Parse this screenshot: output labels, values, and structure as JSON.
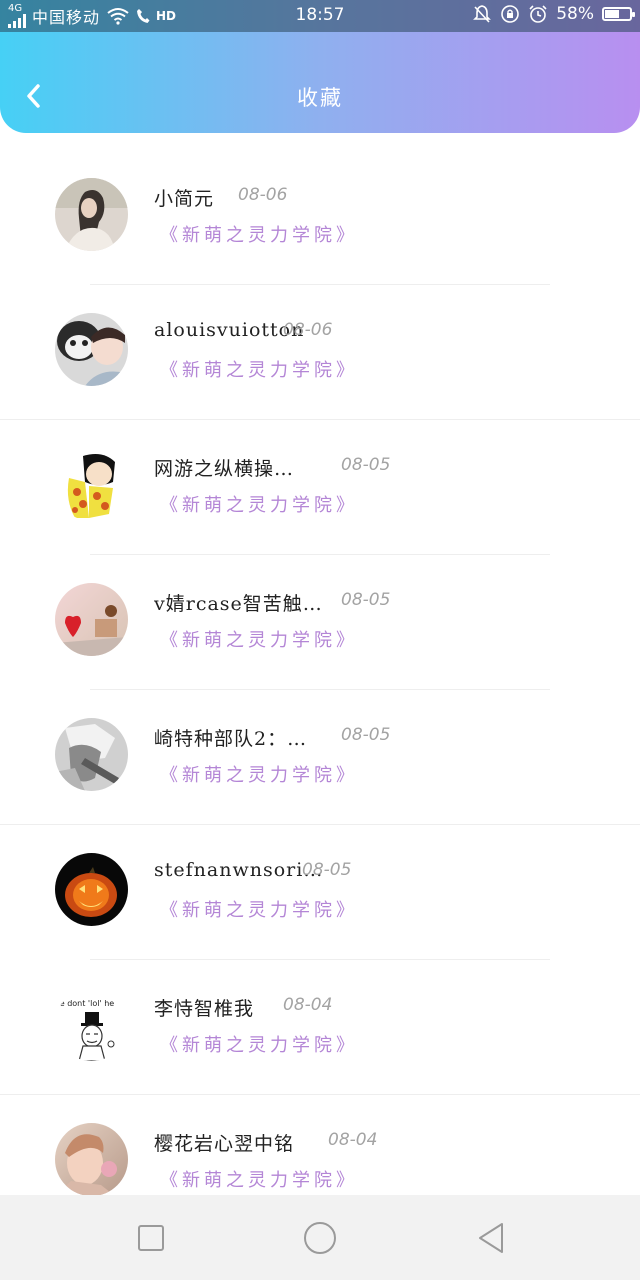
{
  "status_bar": {
    "network": "4G",
    "carrier": "中国移动",
    "hd": "HD",
    "time": "18:57",
    "battery": "58%",
    "battery_level": 0.58
  },
  "header": {
    "title": "收藏",
    "back_icon": "chevron-left-icon"
  },
  "favorites": [
    {
      "name": "小简元",
      "date": "08-06",
      "book": "《新萌之灵力学院》",
      "avatar": "girl-photo"
    },
    {
      "name": "alouisvuiotton",
      "date": "08-06",
      "book": "《新萌之灵力学院》",
      "avatar": "boy-with-panda-photo"
    },
    {
      "name": "网游之纵横操…",
      "date": "08-05",
      "book": "《新萌之灵力学院》",
      "avatar": "cartoon-boy-yellow"
    },
    {
      "name": "v婧rcase智苦触…",
      "date": "08-05",
      "book": "《新萌之灵力学院》",
      "avatar": "heart-toy-photo"
    },
    {
      "name": "崎特种部队2：…",
      "date": "08-05",
      "book": "《新萌之灵力学院》",
      "avatar": "anime-grey-sketch"
    },
    {
      "name": "stefnanwnsoricci",
      "date": "08-05",
      "book": "《新萌之灵力学院》",
      "avatar": "pumpkin-lantern"
    },
    {
      "name": "李恃智椎我",
      "date": "08-04",
      "book": "《新萌之灵力学院》",
      "avatar": "meme-lol-caption",
      "avatar_caption": "ve dont 'lol' he"
    },
    {
      "name": "樱花岩心翌中铭",
      "date": "08-04",
      "book": "《新萌之灵力学院》",
      "avatar": "child-with-flower-photo"
    }
  ],
  "nav_bar": {
    "recent_icon": "square-recents-icon",
    "home_icon": "circle-home-icon",
    "back_icon": "triangle-back-icon"
  },
  "colors": {
    "header_gradient_start": "#46d0f5",
    "header_gradient_end": "#b88ff0",
    "book_title": "#b486d6",
    "date": "#a3a3a3"
  }
}
